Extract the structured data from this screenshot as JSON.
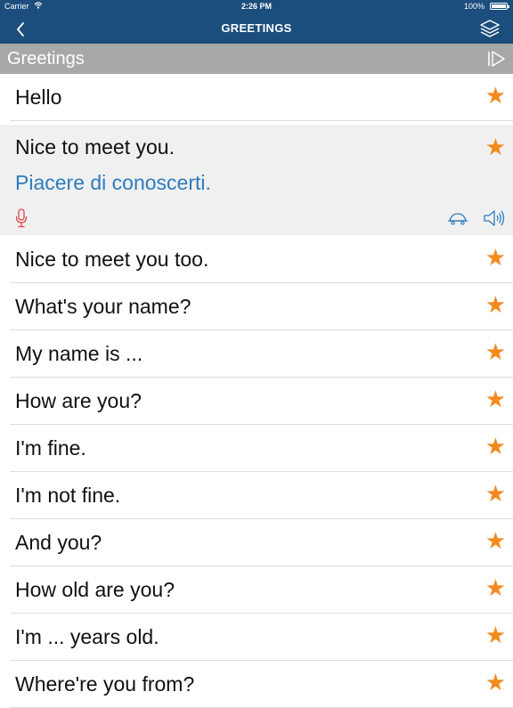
{
  "status_bar": {
    "carrier": "Carrier",
    "time": "2:26 PM",
    "battery": "100%"
  },
  "nav": {
    "title": "GREETINGS"
  },
  "section": {
    "title": "Greetings"
  },
  "colors": {
    "nav_bg": "#1b4e7d",
    "section_bg": "#a8a8a8",
    "star": "#f28a1e",
    "translation": "#2d7bc0",
    "mic": "#e0434a"
  },
  "phrases": [
    {
      "text": "Hello",
      "starred": true
    },
    {
      "text": "Nice to meet you.",
      "starred": true,
      "translation": "Piacere di conoscerti.",
      "expanded": true
    },
    {
      "text": "Nice to meet you too.",
      "starred": true
    },
    {
      "text": "What's your name?",
      "starred": true
    },
    {
      "text": "My name is ...",
      "starred": true
    },
    {
      "text": "How are you?",
      "starred": true
    },
    {
      "text": "I'm fine.",
      "starred": true
    },
    {
      "text": "I'm not fine.",
      "starred": true
    },
    {
      "text": "And you?",
      "starred": true
    },
    {
      "text": "How old are you?",
      "starred": true
    },
    {
      "text": "I'm ... years old.",
      "starred": true
    },
    {
      "text": "Where're you from?",
      "starred": true
    }
  ],
  "icons": {
    "star": "★",
    "back": "chevron-left-icon",
    "layers": "layers-icon",
    "play": "play-icon",
    "mic": "microphone-icon",
    "turtle": "turtle-icon",
    "speaker": "speaker-icon"
  }
}
